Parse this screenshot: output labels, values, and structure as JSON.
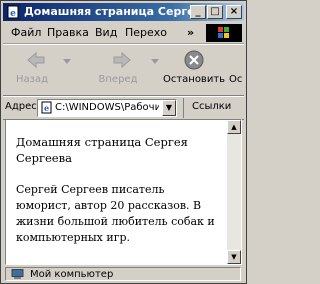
{
  "window": {
    "title": "Домашняя страница Сергея",
    "minimize": "_",
    "maximize": "□",
    "close": "×"
  },
  "menubar": {
    "items": [
      "Файл",
      "Правка",
      "Вид",
      "Перехо"
    ],
    "more": "»"
  },
  "toolbar": {
    "back_label": "Назад",
    "forward_label": "Вперед",
    "stop_label": "Остановить",
    "refresh_label": "Ос"
  },
  "address": {
    "label": "Адрес",
    "value": "C:\\WINDOWS\\Рабочий",
    "links": "Ссылки"
  },
  "content": {
    "heading": "Домашняя страница Сергея Сергеева",
    "paragraph": "Сергей Сергеев писатель юморист, автор 20 рассказов. В жизни большой любитель собак и компьютерных игр."
  },
  "status": {
    "text": "Мой компьютер"
  }
}
